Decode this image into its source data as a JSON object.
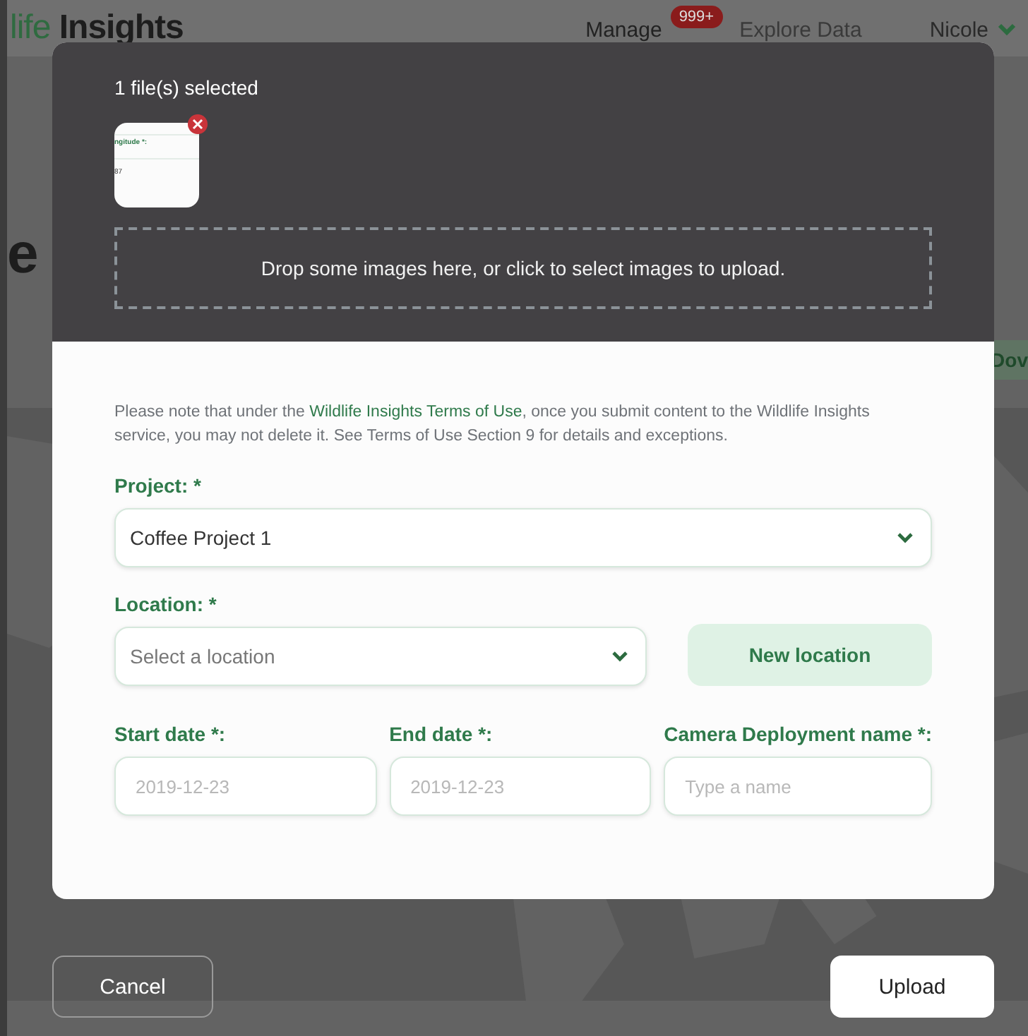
{
  "header": {
    "logo": [
      "life",
      "Insights"
    ],
    "nav": [
      {
        "label": "Manage",
        "badge": "999+"
      },
      {
        "label": "Explore Data"
      }
    ],
    "user": "Nicole"
  },
  "page": {
    "heading": "e",
    "download_button": "Dov"
  },
  "modal": {
    "selected_text": "1 file(s) selected",
    "thumbnail": {
      "texts": [
        "ngitude *:",
        "87"
      ]
    },
    "dropzone_text": "Drop some images here, or click to select images to upload.",
    "notice": {
      "before": "Please note that under the ",
      "link": "Wildlife Insights Terms of Use",
      "after": ", once you submit content to the Wildlife Insights service, you may not delete it. See Terms of Use Section 9 for details and exceptions."
    },
    "project": {
      "label": "Project: *",
      "value": "Coffee Project 1"
    },
    "location": {
      "label": "Location: *",
      "placeholder": "Select a location"
    },
    "new_location_button": "New location",
    "fields": [
      {
        "label": "Start date *:",
        "placeholder": "2019-12-23"
      },
      {
        "label": "End date *:",
        "placeholder": "2019-12-23"
      },
      {
        "label": "Camera Deployment name *:",
        "placeholder": "Type a name"
      }
    ]
  },
  "actions": {
    "cancel": "Cancel",
    "upload": "Upload"
  }
}
